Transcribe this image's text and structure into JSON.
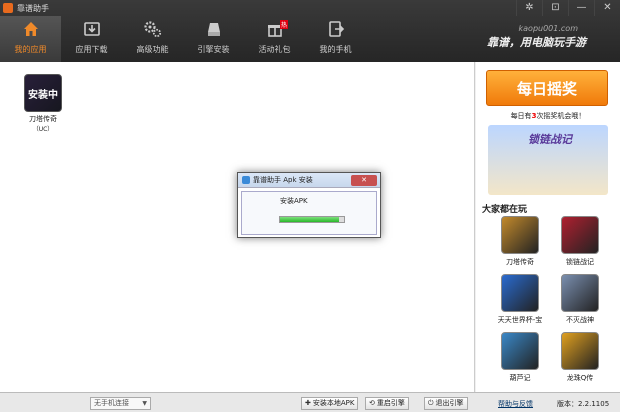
{
  "app": {
    "title": "靠谱助手",
    "url": "kaopu001.com",
    "slogan": "靠谱，用电脑玩手游"
  },
  "window_controls": {
    "settings": "✲",
    "skin": "⊡",
    "minimize": "—",
    "close": "✕"
  },
  "nav": [
    {
      "label": "我的应用",
      "icon": "home-icon"
    },
    {
      "label": "应用下载",
      "icon": "download-icon"
    },
    {
      "label": "高级功能",
      "icon": "gears-icon"
    },
    {
      "label": "引擎安装",
      "icon": "drive-icon"
    },
    {
      "label": "活动礼包",
      "icon": "gift-icon",
      "badge": "热"
    },
    {
      "label": "我的手机",
      "icon": "phone-exit-icon"
    }
  ],
  "my_apps": [
    {
      "name": "刀塔传奇",
      "sub": "（UC）",
      "overlay": "安装中"
    }
  ],
  "dialog": {
    "title": "靠谱助手 Apk 安装",
    "close": "✕",
    "status": "安装APK",
    "progress": 0.92
  },
  "sidebar": {
    "daily_button": "每日摇奖",
    "daily_prefix": "每日有",
    "daily_count": "3",
    "daily_suffix": "次摇奖机会哦！",
    "banner_title": "锁链战记",
    "section_title": "大家都在玩",
    "games": [
      {
        "name": "刀塔传奇",
        "color": "#c38a2c"
      },
      {
        "name": "锁链战记",
        "color": "#b02030"
      },
      {
        "name": "天天世界杯-宝",
        "color": "#2a6bd0"
      },
      {
        "name": "不灭战神",
        "color": "#7a8fb0"
      },
      {
        "name": "葫芦记",
        "color": "#3a88c8"
      },
      {
        "name": "龙珠Q传",
        "color": "#e0a020"
      }
    ]
  },
  "statusbar": {
    "phone_select": "无手机连接",
    "install_local": "安装本地APK",
    "restart_engine": "重启引擎",
    "exit_engine": "退出引擎",
    "help": "帮助与反馈",
    "version_label": "版本：",
    "version": "2.2.1105"
  },
  "colors": {
    "accent": "#f08a2a",
    "progress": "#29b829",
    "titlebar": "#2e2e2e"
  }
}
